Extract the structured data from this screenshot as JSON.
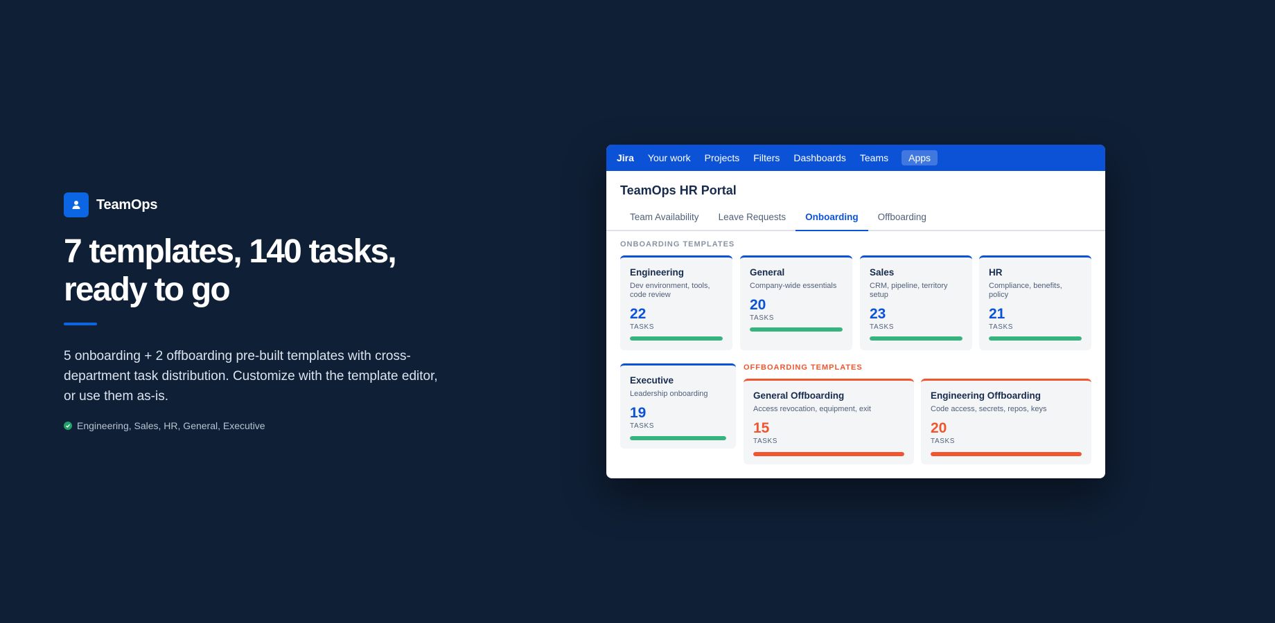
{
  "hero": {
    "brand": "TeamOps",
    "headline": "7 templates, 140 tasks, ready to go",
    "description": "5 onboarding + 2 offboarding pre-built templates with cross-department task distribution. Customize with the template editor, or use them as-is.",
    "tagline": "Engineering, Sales, HR, General, Executive"
  },
  "window": {
    "nav": {
      "logo": "Jira",
      "items": [
        "Your work",
        "Projects",
        "Filters",
        "Dashboards",
        "Teams"
      ],
      "apps": "Apps"
    },
    "title": "TeamOps HR Portal",
    "tabs": [
      "Team Availability",
      "Leave Requests",
      "Onboarding",
      "Offboarding"
    ],
    "active_tab": "Onboarding",
    "onboarding": {
      "label": "ONBOARDING TEMPLATES",
      "cards": [
        {
          "title": "Engineering",
          "desc": "Dev environment, tools, code review",
          "count": "22",
          "unit": "TASKS",
          "progress": 1.0
        },
        {
          "title": "General",
          "desc": "Company-wide essentials",
          "count": "20",
          "unit": "TASKS",
          "progress": 1.0
        },
        {
          "title": "Sales",
          "desc": "CRM, pipeline, territory setup",
          "count": "23",
          "unit": "TASKS",
          "progress": 1.0
        },
        {
          "title": "HR",
          "desc": "Compliance, benefits, policy",
          "count": "21",
          "unit": "TASKS",
          "progress": 1.0
        },
        {
          "title": "Executive",
          "desc": "Leadership onboarding",
          "count": "19",
          "unit": "TASKS",
          "progress": 1.0
        }
      ]
    },
    "offboarding": {
      "label": "OFFBOARDING TEMPLATES",
      "cards": [
        {
          "title": "General Offboarding",
          "desc": "Access revocation, equipment, exit",
          "count": "15",
          "unit": "TASKS",
          "progress": 1.0
        },
        {
          "title": "Engineering Offboarding",
          "desc": "Code access, secrets, repos, keys",
          "count": "20",
          "unit": "TASKS",
          "progress": 1.0
        }
      ]
    }
  },
  "colors": {
    "background": "#0f1f35",
    "brand_blue": "#0c52d6",
    "success_green": "#36b37e",
    "offboard_orange": "#f0552e"
  },
  "icons": {
    "brand": "person-icon",
    "tagline": "check-circle-icon"
  }
}
